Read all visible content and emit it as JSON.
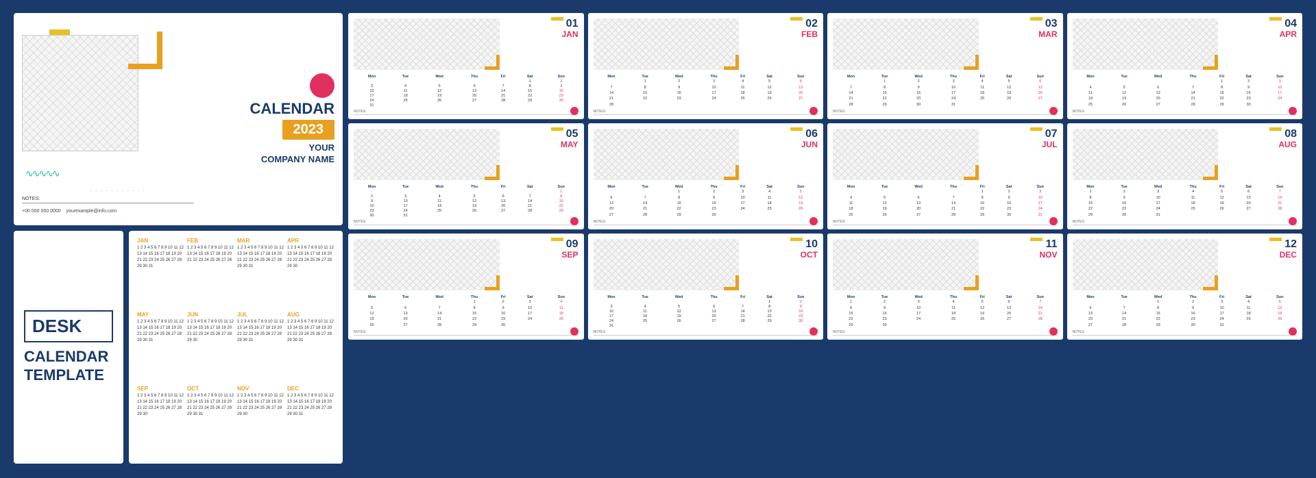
{
  "page": {
    "background": "#1a3a6b"
  },
  "cover": {
    "title": "CALENDAR",
    "year": "2023",
    "company_line1": "YOUR",
    "company_line2": "COMPANY NAME",
    "notes_label": "NOTES:",
    "phone": "+00 000 000 0000",
    "email": "yourexample@info.com"
  },
  "desk_label": {
    "desk": "DESK",
    "calendar_template": "CALENDAR TEMPLATE"
  },
  "months": [
    {
      "num": "01",
      "name": "JAN",
      "days": [
        [
          "",
          "",
          "",
          "",
          "",
          "1",
          "2"
        ],
        [
          "3",
          "4",
          "5",
          "6",
          "7",
          "8",
          "9"
        ],
        [
          "10",
          "11",
          "12",
          "13",
          "14",
          "15",
          "16"
        ],
        [
          "17",
          "18",
          "19",
          "20",
          "21",
          "22",
          "23"
        ],
        [
          "24",
          "25",
          "26",
          "27",
          "28",
          "29",
          "30"
        ],
        [
          "31",
          "",
          "",
          "",
          "",
          "",
          ""
        ]
      ]
    },
    {
      "num": "02",
      "name": "FEB",
      "days": [
        [
          "",
          "1",
          "2",
          "3",
          "4",
          "5",
          "6"
        ],
        [
          "7",
          "8",
          "9",
          "10",
          "11",
          "12",
          "13"
        ],
        [
          "14",
          "15",
          "16",
          "17",
          "18",
          "19",
          "20"
        ],
        [
          "21",
          "22",
          "23",
          "24",
          "25",
          "26",
          "27"
        ],
        [
          "28",
          "",
          "",
          "",
          "",
          "",
          ""
        ]
      ]
    },
    {
      "num": "03",
      "name": "MAR",
      "days": [
        [
          "",
          "1",
          "2",
          "3",
          "4",
          "5",
          "6"
        ],
        [
          "7",
          "8",
          "9",
          "10",
          "11",
          "12",
          "13"
        ],
        [
          "14",
          "15",
          "16",
          "17",
          "18",
          "19",
          "20"
        ],
        [
          "21",
          "22",
          "23",
          "24",
          "25",
          "26",
          "27"
        ],
        [
          "28",
          "29",
          "30",
          "31",
          "",
          "",
          ""
        ]
      ]
    },
    {
      "num": "04",
      "name": "APR",
      "days": [
        [
          "",
          "",
          "",
          "",
          "1",
          "2",
          "3"
        ],
        [
          "4",
          "5",
          "6",
          "7",
          "8",
          "9",
          "10"
        ],
        [
          "11",
          "12",
          "13",
          "14",
          "15",
          "16",
          "17"
        ],
        [
          "18",
          "19",
          "20",
          "21",
          "22",
          "23",
          "24"
        ],
        [
          "25",
          "26",
          "27",
          "28",
          "29",
          "30",
          ""
        ]
      ]
    },
    {
      "num": "05",
      "name": "MAY",
      "days": [
        [
          "",
          "",
          "",
          "",
          "",
          "",
          "1"
        ],
        [
          "2",
          "3",
          "4",
          "5",
          "6",
          "7",
          "8"
        ],
        [
          "9",
          "10",
          "11",
          "12",
          "13",
          "14",
          "15"
        ],
        [
          "16",
          "17",
          "18",
          "19",
          "20",
          "21",
          "22"
        ],
        [
          "23",
          "24",
          "25",
          "26",
          "27",
          "28",
          "29"
        ],
        [
          "30",
          "31",
          "",
          "",
          "",
          "",
          ""
        ]
      ]
    },
    {
      "num": "06",
      "name": "JUN",
      "days": [
        [
          "",
          "",
          "1",
          "2",
          "3",
          "4",
          "5"
        ],
        [
          "6",
          "7",
          "8",
          "9",
          "10",
          "11",
          "12"
        ],
        [
          "13",
          "14",
          "15",
          "16",
          "17",
          "18",
          "19"
        ],
        [
          "20",
          "21",
          "22",
          "23",
          "24",
          "25",
          "26"
        ],
        [
          "27",
          "28",
          "29",
          "30",
          "",
          "",
          ""
        ]
      ]
    },
    {
      "num": "07",
      "name": "JUL",
      "days": [
        [
          "",
          "",
          "",
          "",
          "1",
          "2",
          "3"
        ],
        [
          "4",
          "5",
          "6",
          "7",
          "8",
          "9",
          "10"
        ],
        [
          "11",
          "12",
          "13",
          "14",
          "15",
          "16",
          "17"
        ],
        [
          "18",
          "19",
          "20",
          "21",
          "22",
          "23",
          "24"
        ],
        [
          "25",
          "26",
          "27",
          "28",
          "29",
          "30",
          "31"
        ]
      ]
    },
    {
      "num": "08",
      "name": "AUG",
      "days": [
        [
          "1",
          "2",
          "3",
          "4",
          "5",
          "6",
          "7"
        ],
        [
          "8",
          "9",
          "10",
          "11",
          "12",
          "13",
          "14"
        ],
        [
          "15",
          "16",
          "17",
          "18",
          "19",
          "20",
          "21"
        ],
        [
          "22",
          "23",
          "24",
          "25",
          "26",
          "27",
          "28"
        ],
        [
          "29",
          "30",
          "31",
          "",
          "",
          "",
          ""
        ]
      ]
    },
    {
      "num": "09",
      "name": "SEP",
      "days": [
        [
          "",
          "",
          "",
          "1",
          "2",
          "3",
          "4"
        ],
        [
          "5",
          "6",
          "7",
          "8",
          "9",
          "10",
          "11"
        ],
        [
          "12",
          "13",
          "14",
          "15",
          "16",
          "17",
          "18"
        ],
        [
          "19",
          "20",
          "21",
          "22",
          "23",
          "24",
          "25"
        ],
        [
          "26",
          "27",
          "28",
          "29",
          "30",
          "",
          ""
        ]
      ]
    },
    {
      "num": "10",
      "name": "OCT",
      "days": [
        [
          "",
          "",
          "",
          "",
          "",
          "1",
          "2"
        ],
        [
          "3",
          "4",
          "5",
          "6",
          "7",
          "8",
          "9"
        ],
        [
          "10",
          "11",
          "12",
          "13",
          "14",
          "15",
          "16"
        ],
        [
          "17",
          "18",
          "19",
          "20",
          "21",
          "22",
          "23"
        ],
        [
          "24",
          "25",
          "26",
          "27",
          "28",
          "29",
          "30"
        ],
        [
          "31",
          "",
          "",
          "",
          "",
          "",
          ""
        ]
      ]
    },
    {
      "num": "11",
      "name": "NOV",
      "days": [
        [
          "1",
          "2",
          "3",
          "4",
          "5",
          "6",
          "7"
        ],
        [
          "8",
          "9",
          "10",
          "11",
          "12",
          "13",
          "14"
        ],
        [
          "15",
          "16",
          "17",
          "18",
          "19",
          "20",
          "21"
        ],
        [
          "22",
          "23",
          "24",
          "25",
          "26",
          "27",
          "28"
        ],
        [
          "29",
          "30",
          "",
          "",
          "",
          "",
          ""
        ]
      ]
    },
    {
      "num": "12",
      "name": "DEC",
      "days": [
        [
          "",
          "",
          "1",
          "2",
          "3",
          "4",
          "5"
        ],
        [
          "6",
          "7",
          "8",
          "9",
          "10",
          "11",
          "12"
        ],
        [
          "13",
          "14",
          "15",
          "16",
          "17",
          "18",
          "19"
        ],
        [
          "20",
          "21",
          "22",
          "23",
          "24",
          "25",
          "26"
        ],
        [
          "27",
          "28",
          "29",
          "30",
          "31",
          "",
          ""
        ]
      ]
    }
  ],
  "week_headers": [
    "Mon",
    "Tue",
    "Wed",
    "Thu",
    "Fri",
    "Sat",
    "Sun"
  ],
  "notes_label": "NOTES:"
}
